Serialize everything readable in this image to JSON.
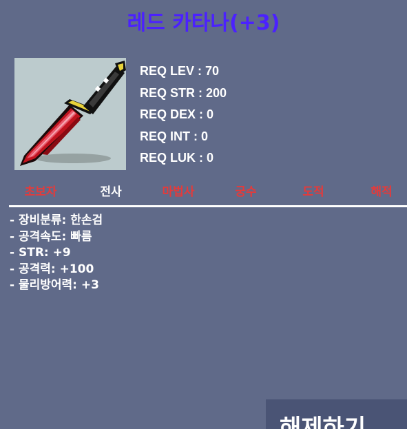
{
  "item": {
    "name": "레드 카타나(+3)",
    "name_color": "#4b21ff",
    "icon": "red-katana-icon"
  },
  "requirements": [
    {
      "label": "REQ LEV : 70"
    },
    {
      "label": "REQ STR : 200"
    },
    {
      "label": "REQ DEX : 0"
    },
    {
      "label": "REQ INT : 0"
    },
    {
      "label": "REQ LUK : 0"
    }
  ],
  "jobs": [
    {
      "label": "초보자",
      "color": "#e53a3a"
    },
    {
      "label": "전사",
      "color": "#ffffff"
    },
    {
      "label": "마법사",
      "color": "#e53a3a"
    },
    {
      "label": "궁수",
      "color": "#e53a3a"
    },
    {
      "label": "도적",
      "color": "#e53a3a"
    },
    {
      "label": "해적",
      "color": "#e53a3a"
    }
  ],
  "stats": [
    {
      "text": "- 장비분류: 한손검"
    },
    {
      "text": "- 공격속도: 빠름"
    },
    {
      "text": "- STR: +9"
    },
    {
      "text": "- 공격력: +100"
    },
    {
      "text": "- 물리방어력: +3"
    }
  ],
  "button": {
    "label": "해제하기"
  },
  "colors": {
    "background": "#606a89",
    "panel": "#bccbcd",
    "button": "#4a5475"
  }
}
